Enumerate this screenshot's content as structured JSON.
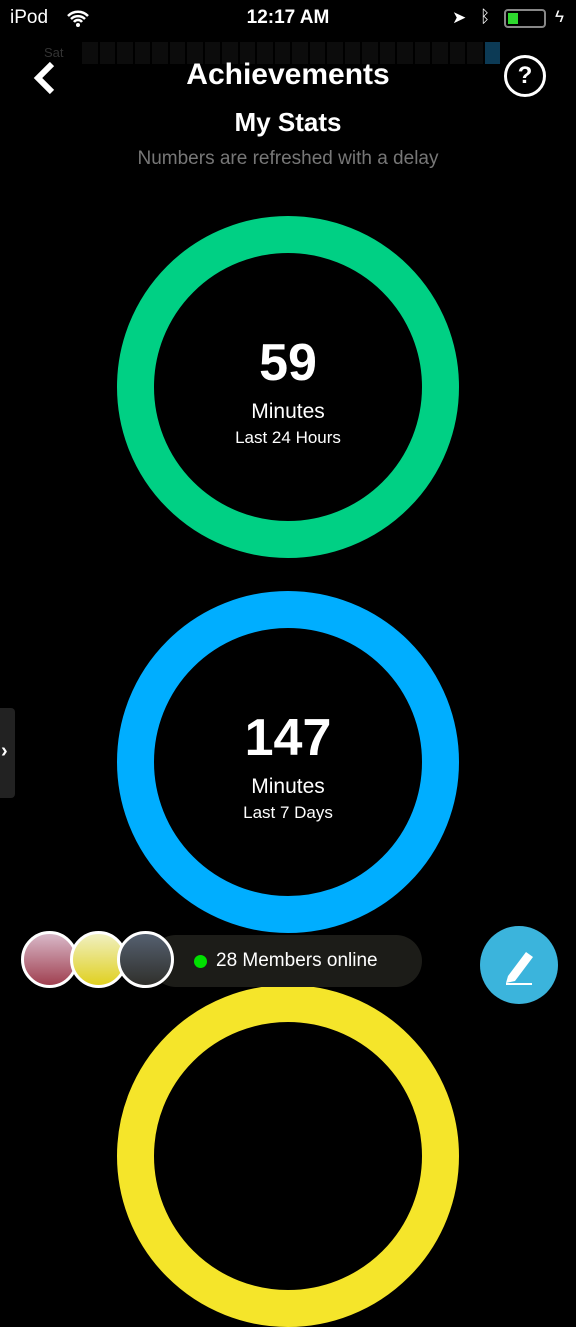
{
  "status_bar": {
    "carrier": "iPod",
    "time": "12:17 AM"
  },
  "strip": {
    "day": "Sat"
  },
  "header": {
    "title": "Achievements",
    "back_icon": "chevron-left-icon",
    "help_label": "?"
  },
  "stats": {
    "title": "My Stats",
    "note": "Numbers are refreshed with a delay",
    "rings": [
      {
        "value": "59",
        "unit": "Minutes",
        "period": "Last 24 Hours",
        "color": "#00d084"
      },
      {
        "value": "147",
        "unit": "Minutes",
        "period": "Last 7 Days",
        "color": "#00aeff"
      },
      {
        "color": "#f5e52a"
      }
    ]
  },
  "online": {
    "label": "28 Members online",
    "dot_color": "#00e000"
  },
  "fab": {
    "icon": "pencil-icon",
    "color": "#3bb4dc"
  }
}
